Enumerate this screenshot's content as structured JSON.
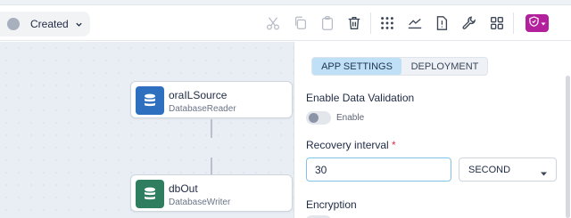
{
  "toolbar": {
    "status": {
      "label": "Created",
      "dot_color": "#a9b0bd"
    },
    "icons": [
      "cut-icon",
      "copy-icon",
      "paste-icon",
      "trash-icon",
      "grid-icon",
      "chart-icon",
      "alert-file-icon",
      "wrench-icon",
      "apps-icon",
      "shield-icon"
    ]
  },
  "flow": {
    "source": {
      "title": "oraILSource",
      "subtitle": "DatabaseReader",
      "icon_color": "#2f6fbf"
    },
    "target": {
      "title": "dbOut",
      "subtitle": "DatabaseWriter",
      "icon_color": "#2f7e60"
    }
  },
  "panel": {
    "tabs": [
      {
        "label": "APP SETTINGS",
        "active": true
      },
      {
        "label": "DEPLOYMENT",
        "active": false
      }
    ],
    "validation": {
      "title": "Enable Data Validation",
      "toggle_label": "Enable"
    },
    "recovery": {
      "title": "Recovery interval",
      "required_mark": "*",
      "value": "30",
      "unit": "SECOND"
    },
    "encryption": {
      "title": "Encryption"
    }
  }
}
